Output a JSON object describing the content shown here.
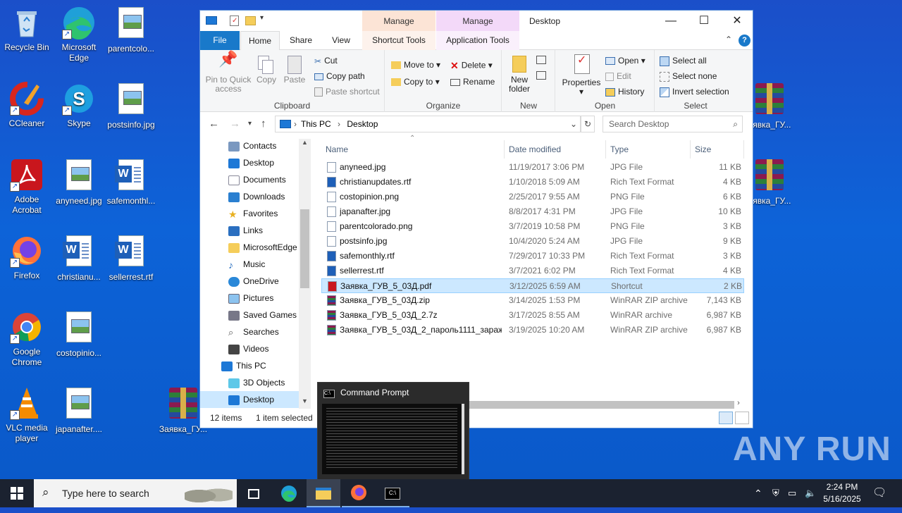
{
  "desktop_icons": [
    {
      "label": "Recycle Bin",
      "icon": "recycle-bin-icon"
    },
    {
      "label": "Microsoft Edge",
      "icon": "edge-icon"
    },
    {
      "label": "parentcolo...",
      "icon": "image-file-icon"
    },
    {
      "label": "CCleaner",
      "icon": "ccleaner-icon"
    },
    {
      "label": "Skype",
      "icon": "skype-icon"
    },
    {
      "label": "postsinfo.jpg",
      "icon": "image-file-icon"
    },
    {
      "label": "Adobe Acrobat",
      "icon": "acrobat-icon"
    },
    {
      "label": "anyneed.jpg",
      "icon": "image-file-icon"
    },
    {
      "label": "safemonthl...",
      "icon": "rtf-file-icon"
    },
    {
      "label": "Firefox",
      "icon": "firefox-icon"
    },
    {
      "label": "christianu...",
      "icon": "rtf-file-icon"
    },
    {
      "label": "sellerrest.rtf",
      "icon": "rtf-file-icon"
    },
    {
      "label": "Google Chrome",
      "icon": "chrome-icon"
    },
    {
      "label": "costopinio...",
      "icon": "image-file-icon"
    },
    {
      "label": "VLC media player",
      "icon": "vlc-icon"
    },
    {
      "label": "japanafter....",
      "icon": "image-file-icon"
    },
    {
      "label": "Заявка_ГУ...",
      "icon": "winrar-icon"
    },
    {
      "label": "аявка_ГУ...",
      "icon": "winrar-icon"
    },
    {
      "label": "аявка_ГУ...",
      "icon": "winrar-icon"
    }
  ],
  "explorer": {
    "title": "Desktop",
    "manage_label_1": "Manage",
    "manage_label_2": "Manage",
    "tabs": {
      "file": "File",
      "home": "Home",
      "share": "Share",
      "view": "View",
      "shortcut_tools": "Shortcut Tools",
      "application_tools": "Application Tools"
    },
    "ribbon": {
      "pin": "Pin to Quick access",
      "copy": "Copy",
      "paste": "Paste",
      "cut": "Cut",
      "copy_path": "Copy path",
      "paste_shortcut": "Paste shortcut",
      "clipboard": "Clipboard",
      "move_to": "Move to",
      "copy_to": "Copy to",
      "delete": "Delete",
      "rename": "Rename",
      "organize": "Organize",
      "new_folder": "New folder",
      "new": "New",
      "properties": "Properties",
      "open": "Open",
      "edit": "Edit",
      "history": "History",
      "open_group": "Open",
      "select_all": "Select all",
      "select_none": "Select none",
      "invert_selection": "Invert selection",
      "select": "Select"
    },
    "address": {
      "root": "This PC",
      "current": "Desktop"
    },
    "search_placeholder": "Search Desktop",
    "nav_items": [
      "Contacts",
      "Desktop",
      "Documents",
      "Downloads",
      "Favorites",
      "Links",
      "MicrosoftEdge",
      "Music",
      "OneDrive",
      "Pictures",
      "Saved Games",
      "Searches",
      "Videos",
      "This PC",
      "3D Objects",
      "Desktop"
    ],
    "columns": {
      "name": "Name",
      "date": "Date modified",
      "type": "Type",
      "size": "Size"
    },
    "files": [
      {
        "name": "anyneed.jpg",
        "date": "11/19/2017 3:06 PM",
        "type": "JPG File",
        "size": "11 KB"
      },
      {
        "name": "christianupdates.rtf",
        "date": "1/10/2018 5:09 AM",
        "type": "Rich Text Format",
        "size": "4 KB"
      },
      {
        "name": "costopinion.png",
        "date": "2/25/2017 9:55 AM",
        "type": "PNG File",
        "size": "6 KB"
      },
      {
        "name": "japanafter.jpg",
        "date": "8/8/2017 4:31 PM",
        "type": "JPG File",
        "size": "10 KB"
      },
      {
        "name": "parentcolorado.png",
        "date": "3/7/2019 10:58 PM",
        "type": "PNG File",
        "size": "3 KB"
      },
      {
        "name": "postsinfo.jpg",
        "date": "10/4/2020 5:24 AM",
        "type": "JPG File",
        "size": "9 KB"
      },
      {
        "name": "safemonthly.rtf",
        "date": "7/29/2017 10:33 PM",
        "type": "Rich Text Format",
        "size": "3 KB"
      },
      {
        "name": "sellerrest.rtf",
        "date": "3/7/2021 6:02 PM",
        "type": "Rich Text Format",
        "size": "4 KB"
      },
      {
        "name": "Заявка_ГУВ_5_03Д.pdf",
        "date": "3/12/2025 6:59 AM",
        "type": "Shortcut",
        "size": "2 KB"
      },
      {
        "name": "Заявка_ГУВ_5_03Д.zip",
        "date": "3/14/2025 1:53 PM",
        "type": "WinRAR ZIP archive",
        "size": "7,143 KB"
      },
      {
        "name": "Заявка_ГУВ_5_03Д_2.7z",
        "date": "3/17/2025 8:55 AM",
        "type": "WinRAR archive",
        "size": "6,987 KB"
      },
      {
        "name": "Заявка_ГУВ_5_03Д_2_пароль1111_зараж...",
        "date": "3/19/2025 10:20 AM",
        "type": "WinRAR ZIP archive",
        "size": "6,987 KB"
      }
    ],
    "status": {
      "count": "12 items",
      "selected": "1 item selected"
    }
  },
  "cmd_preview": {
    "title": "Command Prompt"
  },
  "taskbar": {
    "search_placeholder": "Type here to search",
    "time": "2:24 PM",
    "date": "5/16/2025"
  },
  "watermark": "ANY RUN"
}
